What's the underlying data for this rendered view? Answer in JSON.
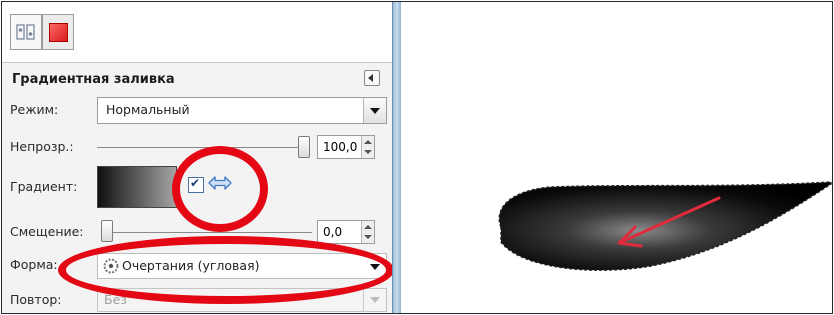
{
  "panel": {
    "title": "Градиентная заливка",
    "mode_label": "Режим:",
    "mode_value": "Нормальный",
    "opacity_label": "Непрозр.:",
    "opacity_value": "100,0",
    "opacity_level": 1.0,
    "gradient_label": "Градиент:",
    "reverse_checked": true,
    "offset_label": "Смещение:",
    "offset_value": "0,0",
    "offset_level": 0.0,
    "shape_label": "Форма:",
    "shape_value": "Очертания (угловая)",
    "repeat_label": "Повтор:",
    "repeat_value": "Без"
  },
  "icons": {
    "tab1": "tool-options-icon",
    "tab2": "red-square-icon",
    "collapse": "collapse-left-icon",
    "reverse": "swap-arrows-icon",
    "shape": "shape-corner-icon"
  },
  "colors": {
    "highlight_ring": "#e30814",
    "arrow": "#e02b3c",
    "gradient_start": "#101010",
    "gradient_end": "#a5a5a5"
  }
}
